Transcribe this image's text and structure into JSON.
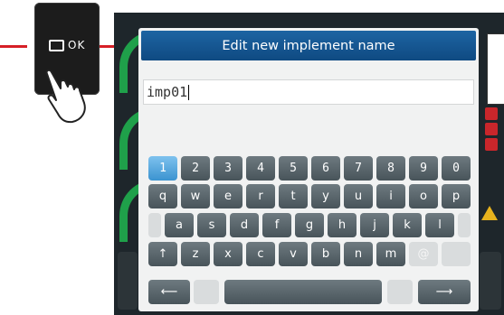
{
  "physical_key": {
    "label": "OK"
  },
  "dialog": {
    "title": "Edit new implement name",
    "field_value": "imp01"
  },
  "keyboard": {
    "number_row": [
      "1",
      "2",
      "3",
      "4",
      "5",
      "6",
      "7",
      "8",
      "9",
      "0"
    ],
    "row_q": [
      "q",
      "w",
      "e",
      "r",
      "t",
      "y",
      "u",
      "i",
      "o",
      "p"
    ],
    "row_a": [
      "a",
      "s",
      "d",
      "f",
      "g",
      "h",
      "j",
      "k",
      "l"
    ],
    "row_z": [
      "z",
      "x",
      "c",
      "v",
      "b",
      "n",
      "m",
      "@"
    ],
    "shift_label": "↑",
    "backspace_label": "⟵",
    "enter_label": "⟶",
    "selected_key": "1"
  },
  "colors": {
    "accent_red": "#d61f26",
    "title_blue": "#1d64a3",
    "key_gray": "#5c686e",
    "key_selected": "#4aa3dd",
    "background_green": "#1fa04a"
  }
}
